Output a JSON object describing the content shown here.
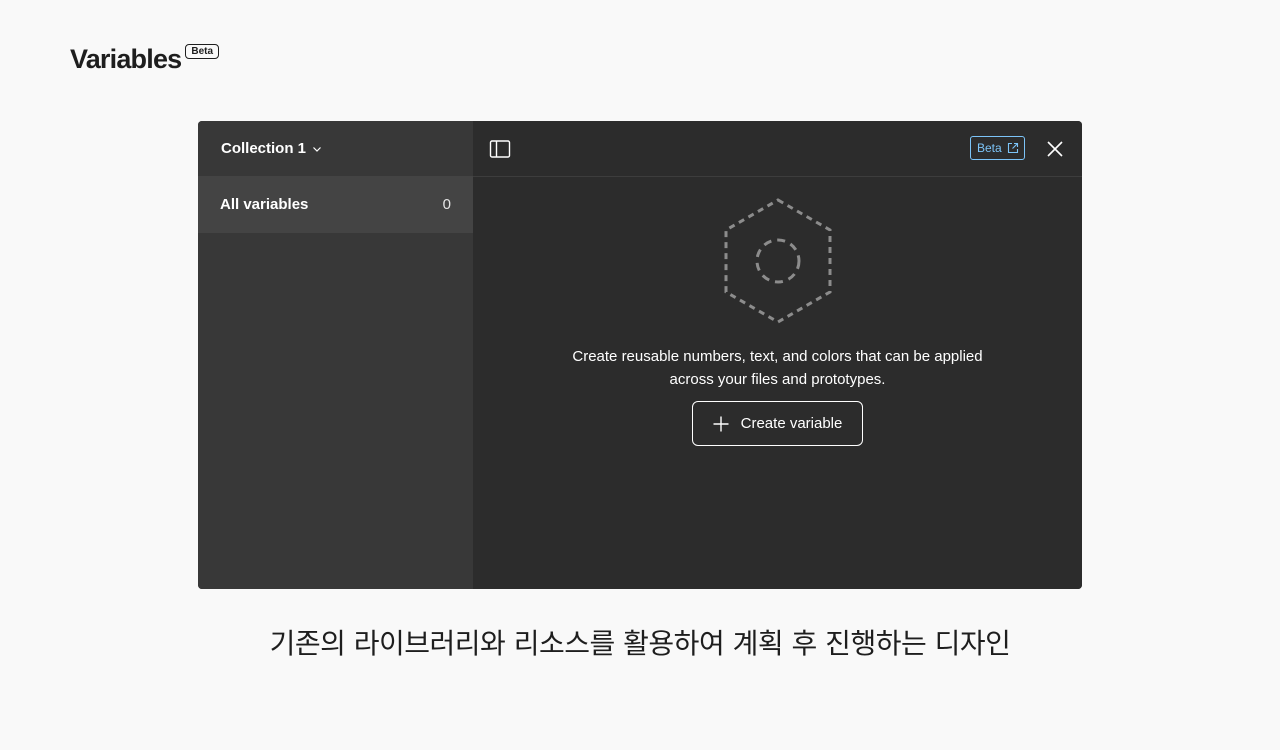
{
  "heading": {
    "title": "Variables",
    "badge": "Beta"
  },
  "sidebar": {
    "collection_label": "Collection 1",
    "collection_icon": "chevron-down-icon",
    "items": [
      {
        "label": "All variables",
        "count": "0"
      }
    ]
  },
  "toolbar": {
    "panel_icon": "sidebar-panel-icon",
    "beta_label": "Beta",
    "beta_icon": "external-link-icon",
    "close_icon": "close-icon"
  },
  "empty_state": {
    "illustration": "dashed-hexagon-icon",
    "description": "Create reusable numbers, text, and colors that can be applied across your files and prototypes.",
    "create_button": "Create variable",
    "create_icon": "plus-icon"
  },
  "caption": "기존의 라이브러리와 리소스를 활용하여 계획 후 진행하는 디자인",
  "colors": {
    "sidebar_bg": "#383838",
    "selected_row_bg": "#444444",
    "main_bg": "#2c2c2c",
    "beta_accent": "#7cc4f8",
    "page_bg": "#f9f9f9"
  }
}
